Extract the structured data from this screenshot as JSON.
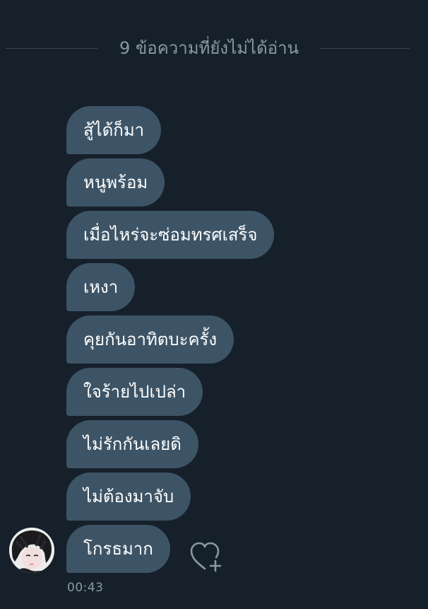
{
  "unread_divider": {
    "text": "9 ข้อความที่ยังไม่ได้อ่าน"
  },
  "messages": [
    "สู้ได้ก็มา",
    "หนูพร้อม",
    "เมื่อไหร่จะซ่อมทรศเสร็จ",
    "เหงา",
    "คุยกันอาทิตบะครั้ง",
    "ใจร้ายไปเปล่า",
    "ไม่รักกันเลยดิ",
    "ไม่ต้องมาจับ",
    "โกรธมาก"
  ],
  "message_meta": {
    "timestamp": "00:43"
  },
  "icons": {
    "avatar": "sender-avatar",
    "reaction": "heart-plus-icon"
  },
  "colors": {
    "background": "#16202b",
    "bubble": "#3d5466",
    "muted_text": "#8899a6",
    "divider_line": "#38444d"
  }
}
